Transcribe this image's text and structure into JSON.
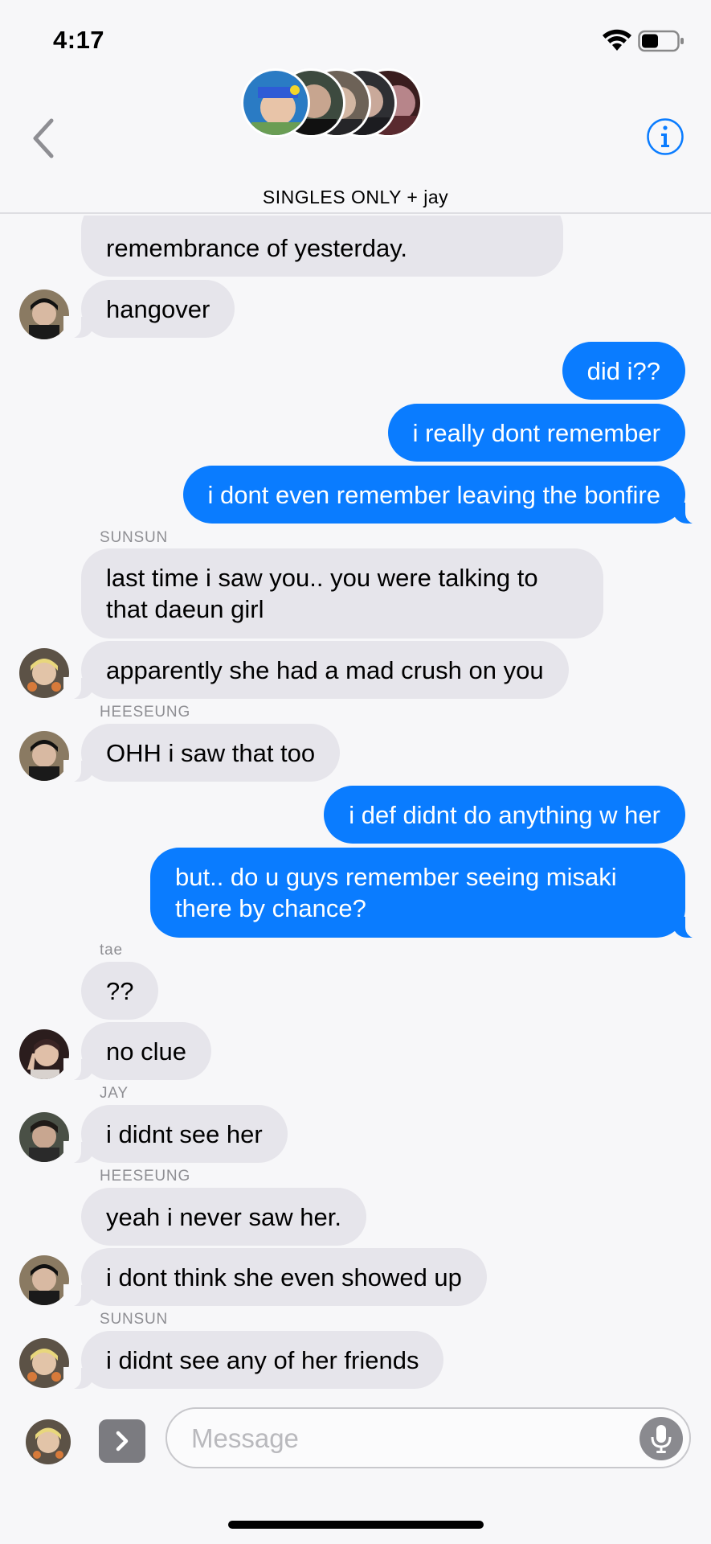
{
  "status_bar": {
    "time": "4:17",
    "wifi_icon": "wifi-icon",
    "battery_icon": "battery-icon"
  },
  "header": {
    "title": "SINGLES ONLY + jay",
    "back_icon": "chevron-left-icon",
    "info_icon": "info-icon",
    "avatar_count": 5
  },
  "messages": [
    {
      "dir": "in",
      "text": "remembrance of yesterday."
    },
    {
      "dir": "in",
      "text": "hangover"
    },
    {
      "dir": "out",
      "text": "did i??"
    },
    {
      "dir": "out",
      "text": "i really dont remember"
    },
    {
      "dir": "out",
      "text": "i dont even remember leaving the bonfire"
    },
    {
      "dir": "in",
      "sender": "SUNSUN",
      "text": "last time i saw you.. you were talking to that daeun girl"
    },
    {
      "dir": "in",
      "text": "apparently she had a mad crush on you"
    },
    {
      "dir": "in",
      "sender": "HEESEUNG",
      "text": "OHH i saw that too"
    },
    {
      "dir": "out",
      "text": "i def didnt do anything w her"
    },
    {
      "dir": "out",
      "text": "but.. do u guys remember seeing misaki there by chance?"
    },
    {
      "dir": "in",
      "sender": "tae",
      "text": "??"
    },
    {
      "dir": "in",
      "text": "no clue"
    },
    {
      "dir": "in",
      "sender": "JAY",
      "text": "i didnt see her"
    },
    {
      "dir": "in",
      "sender": "HEESEUNG",
      "text": "yeah i never saw her."
    },
    {
      "dir": "in",
      "text": "i dont think she even showed up"
    },
    {
      "dir": "in",
      "sender": "SUNSUN",
      "text": "i didnt see any of her friends"
    }
  ],
  "input": {
    "placeholder": "Message",
    "apps_icon": "chevron-right-icon",
    "mic_icon": "microphone-icon"
  },
  "colors": {
    "outgoing": "#0a7cff",
    "incoming": "#e6e5eb",
    "background": "#f7f7f9",
    "sender_label": "#8e8e93"
  }
}
